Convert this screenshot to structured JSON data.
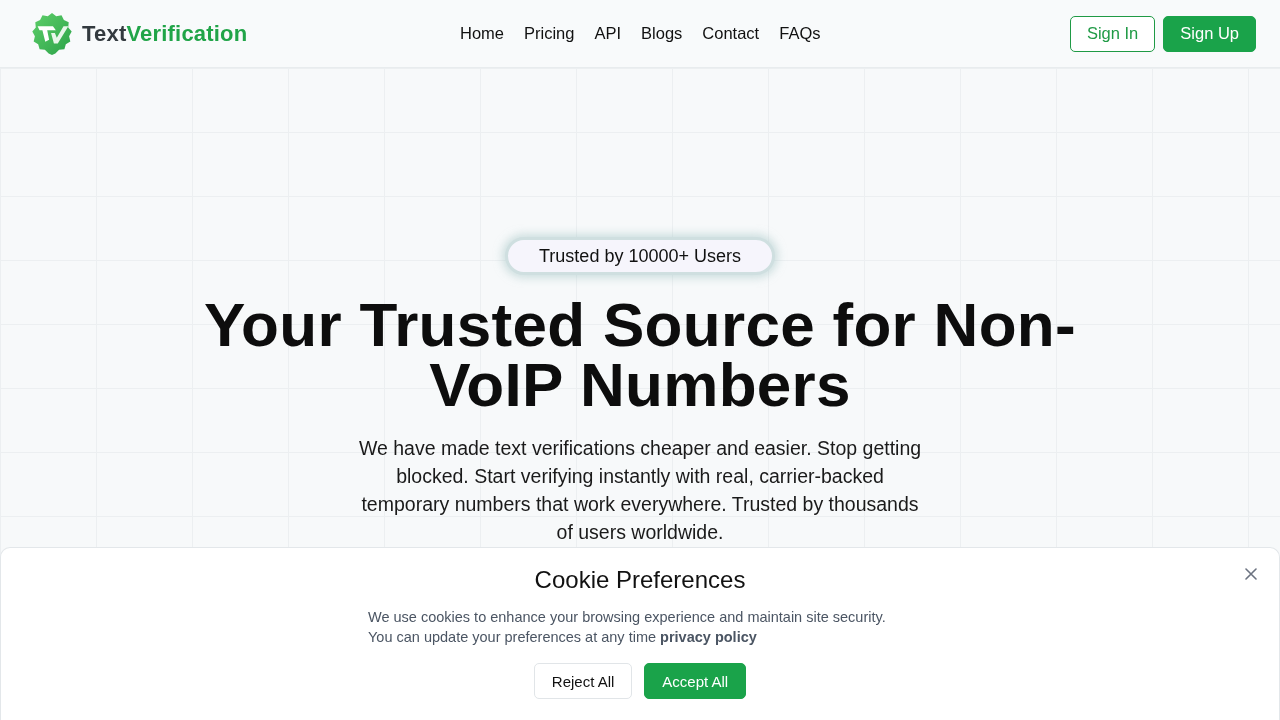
{
  "header": {
    "brand": {
      "parts": [
        {
          "text": "Text",
          "kind": "plain"
        },
        {
          "text": "Verification",
          "kind": "accent"
        }
      ]
    },
    "nav": [
      {
        "label": "Home"
      },
      {
        "label": "Pricing"
      },
      {
        "label": "API"
      },
      {
        "label": "Blogs"
      },
      {
        "label": "Contact"
      },
      {
        "label": "FAQs"
      }
    ],
    "buttons": [
      {
        "label": "Sign In",
        "kind": "outline"
      },
      {
        "label": "Sign Up",
        "kind": "primary"
      }
    ]
  },
  "hero": {
    "badge": "Trusted by 10000+ Users",
    "title": "Your Trusted Source for Non-VoIP Numbers",
    "text": "We have made text verifications cheaper and easier. Stop getting blocked. Start verifying instantly with real, carrier-backed temporary numbers that work everywhere. Trusted by thousands of users worldwide."
  },
  "cookie_banner": {
    "title": "Cookie Preferences",
    "lines": [
      "We use cookies to enhance your browsing experience and maintain site security.",
      "You can update your preferences at any time"
    ],
    "link": "privacy policy",
    "buttons": [
      {
        "label": "Reject All",
        "kind": "outline"
      },
      {
        "label": "Accept All",
        "kind": "primary"
      }
    ]
  }
}
